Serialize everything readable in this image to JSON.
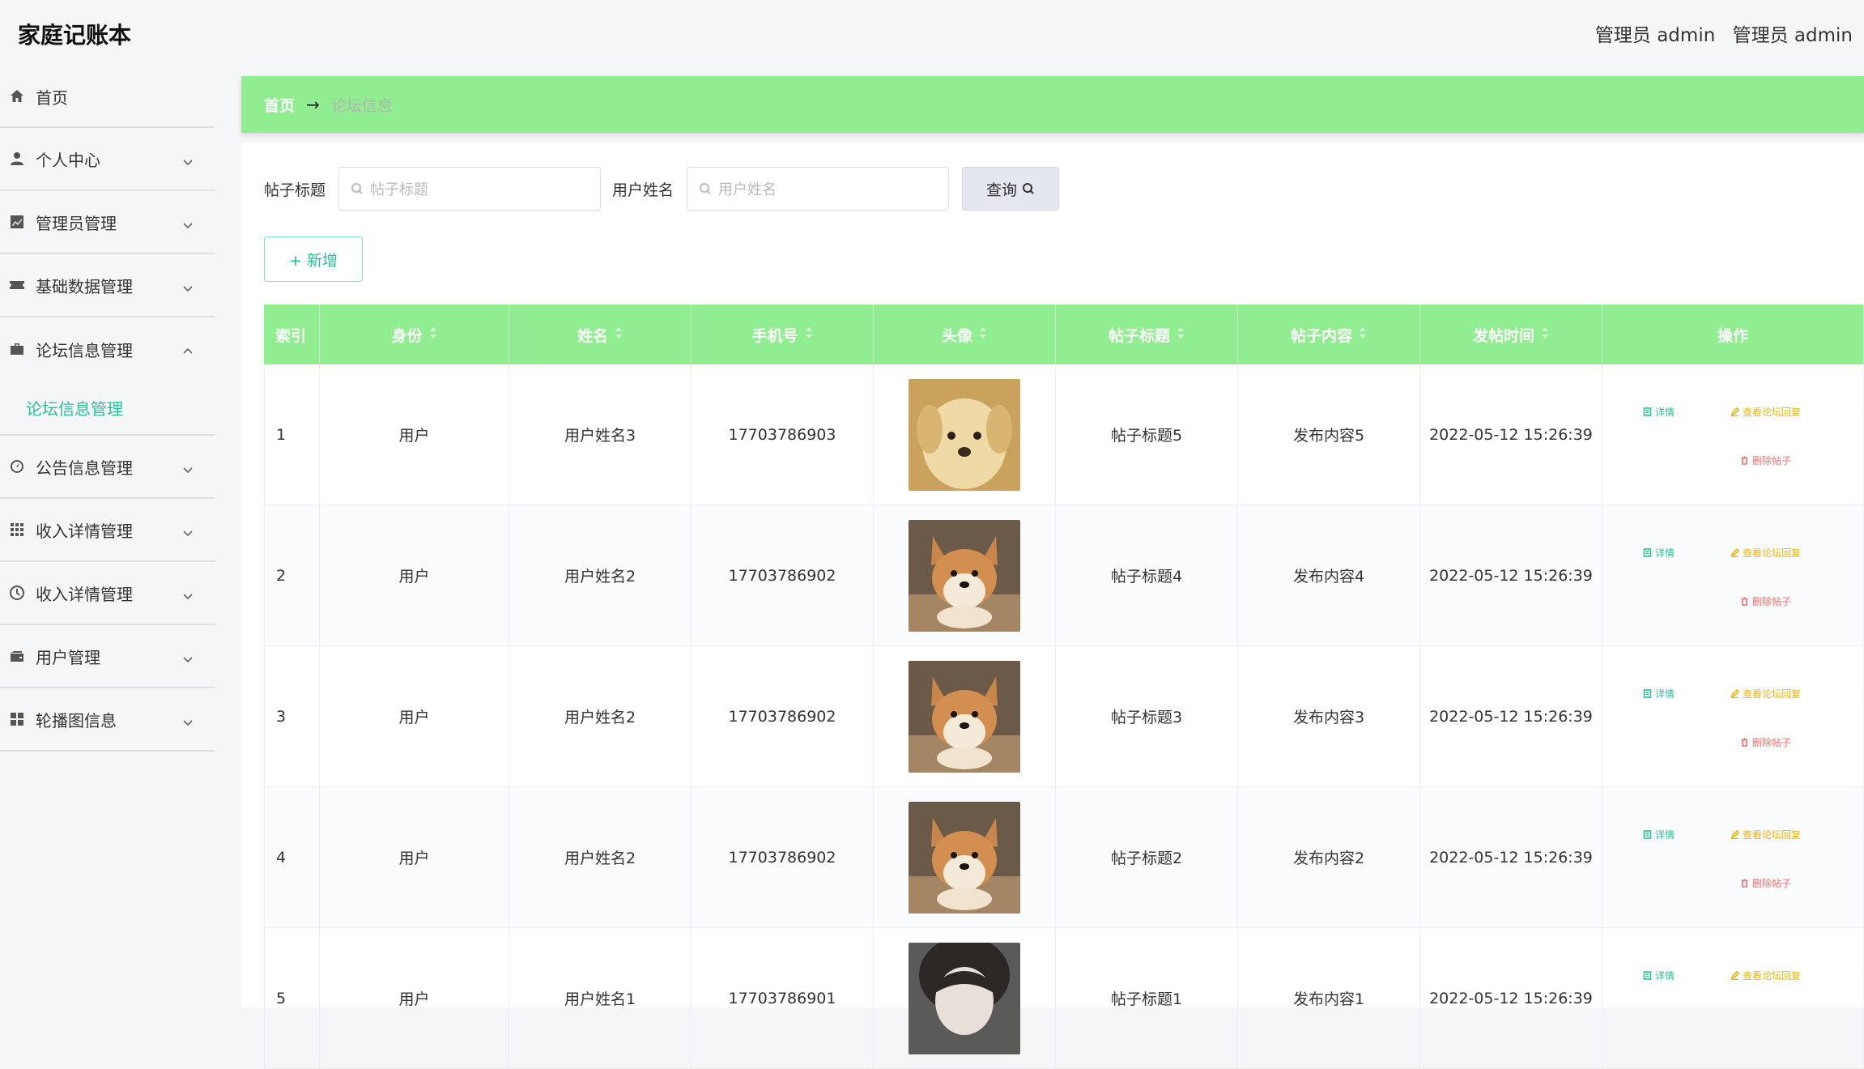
{
  "app": {
    "title": "家庭记账本",
    "user_role_1": "管理员 admin",
    "user_role_2": "管理员 admin"
  },
  "sidebar": {
    "items": [
      {
        "label": "首页",
        "icon": "home-icon",
        "expandable": false
      },
      {
        "label": "个人中心",
        "icon": "user-icon",
        "expandable": true
      },
      {
        "label": "管理员管理",
        "icon": "chart-icon",
        "expandable": true
      },
      {
        "label": "基础数据管理",
        "icon": "ticket-icon",
        "expandable": true
      },
      {
        "label": "论坛信息管理",
        "icon": "briefcase-icon",
        "expandable": true,
        "open": true
      },
      {
        "label": "公告信息管理",
        "icon": "dashboard-icon",
        "expandable": true
      },
      {
        "label": "收入详情管理",
        "icon": "grid-icon",
        "expandable": true
      },
      {
        "label": "收入详情管理",
        "icon": "clock-icon",
        "expandable": true
      },
      {
        "label": "用户管理",
        "icon": "wallet-icon",
        "expandable": true
      },
      {
        "label": "轮播图信息",
        "icon": "apps-icon",
        "expandable": true
      }
    ],
    "sub_item": "论坛信息管理"
  },
  "breadcrumb": {
    "home": "首页",
    "arrow": "→",
    "current": "论坛信息"
  },
  "search": {
    "title_label": "帖子标题",
    "title_placeholder": "帖子标题",
    "name_label": "用户姓名",
    "name_placeholder": "用户姓名",
    "query_label": "查询"
  },
  "add_button": "+ 新增",
  "table": {
    "headers": [
      "索引",
      "身份",
      "姓名",
      "手机号",
      "头像",
      "帖子标题",
      "帖子内容",
      "发帖时间",
      "操作"
    ],
    "rows": [
      {
        "index": "1",
        "role": "用户",
        "name": "用户姓名3",
        "phone": "17703786903",
        "avatar": "puppy-photo",
        "title": "帖子标题5",
        "content": "发布内容5",
        "time": "2022-05-12 15:26:39"
      },
      {
        "index": "2",
        "role": "用户",
        "name": "用户姓名2",
        "phone": "17703786902",
        "avatar": "shiba-photo",
        "title": "帖子标题4",
        "content": "发布内容4",
        "time": "2022-05-12 15:26:39"
      },
      {
        "index": "3",
        "role": "用户",
        "name": "用户姓名2",
        "phone": "17703786902",
        "avatar": "shiba-photo",
        "title": "帖子标题3",
        "content": "发布内容3",
        "time": "2022-05-12 15:26:39"
      },
      {
        "index": "4",
        "role": "用户",
        "name": "用户姓名2",
        "phone": "17703786902",
        "avatar": "shiba-photo",
        "title": "帖子标题2",
        "content": "发布内容2",
        "time": "2022-05-12 15:26:39"
      },
      {
        "index": "5",
        "role": "用户",
        "name": "用户姓名1",
        "phone": "17703786901",
        "avatar": "girl-photo",
        "title": "帖子标题1",
        "content": "发布内容1",
        "time": "2022-05-12 15:26:39"
      }
    ],
    "ops": {
      "detail": "详情",
      "reply": "查看论坛回复",
      "delete": "删除帖子"
    }
  },
  "colors": {
    "accent": "#90ee90",
    "teal": "#2bbf9c",
    "warning": "#f2b400",
    "danger": "#f56c6c"
  }
}
